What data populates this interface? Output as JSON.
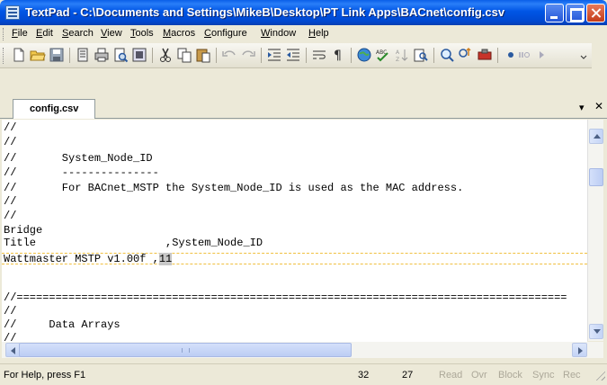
{
  "window": {
    "title": "TextPad - C:\\Documents and Settings\\MikeB\\Desktop\\PT Link Apps\\BACnet\\config.csv"
  },
  "menu": [
    {
      "label": "File",
      "u": "F",
      "rest": "ile"
    },
    {
      "label": "Edit",
      "u": "E",
      "rest": "dit"
    },
    {
      "label": "Search",
      "u": "S",
      "rest": "earch"
    },
    {
      "label": "View",
      "u": "V",
      "rest": "iew"
    },
    {
      "label": "Tools",
      "u": "T",
      "rest": "ools"
    },
    {
      "label": "Macros",
      "u": "M",
      "rest": "acros"
    },
    {
      "label": "Configure",
      "u": "C",
      "rest": "onfigure"
    },
    {
      "label": "Window",
      "u": "W",
      "rest": "indow"
    },
    {
      "label": "Help",
      "u": "H",
      "rest": "elp"
    }
  ],
  "toolbar": {
    "icons": [
      "new-file-icon",
      "open-folder-icon",
      "save-icon",
      "save-all-icon",
      "print-icon",
      "print-preview-icon",
      "document-properties-icon",
      "cut-icon",
      "copy-icon",
      "paste-icon",
      "undo-icon",
      "redo-icon",
      "indent-icon",
      "outdent-icon",
      "word-wrap-icon",
      "pilcrow-icon",
      "web-icon",
      "spelling-icon",
      "sort-icon",
      "find-in-files-icon",
      "find-icon",
      "replace-icon",
      "tools-icon",
      "macro-record-icon",
      "macro-play-icon",
      "macro-next-icon"
    ]
  },
  "tab": {
    "label": "config.csv"
  },
  "editor": {
    "lines": [
      "//",
      "//",
      "//       System_Node_ID",
      "//       ---------------",
      "//       For BACnet_MSTP the System_Node_ID is used as the MAC address.",
      "//",
      "//",
      "Bridge",
      "Title                    ,System_Node_ID",
      "Wattmaster MSTP v1.00f ,11",
      "",
      "",
      "",
      "//=====================================================================================",
      "//",
      "//     Data Arrays",
      "//"
    ],
    "current_line_prefix": "Wattmaster MSTP v1.00f ,",
    "current_line_selected": "11"
  },
  "status": {
    "help": "For Help, press F1",
    "line": "32",
    "column": "27",
    "indicators": [
      "Read",
      "Ovr",
      "Block",
      "Sync",
      "Rec"
    ]
  },
  "colors": {
    "title_bar": "#0055e5",
    "current_line_border": "#f0c040",
    "indicator_dim": "#aca899"
  }
}
